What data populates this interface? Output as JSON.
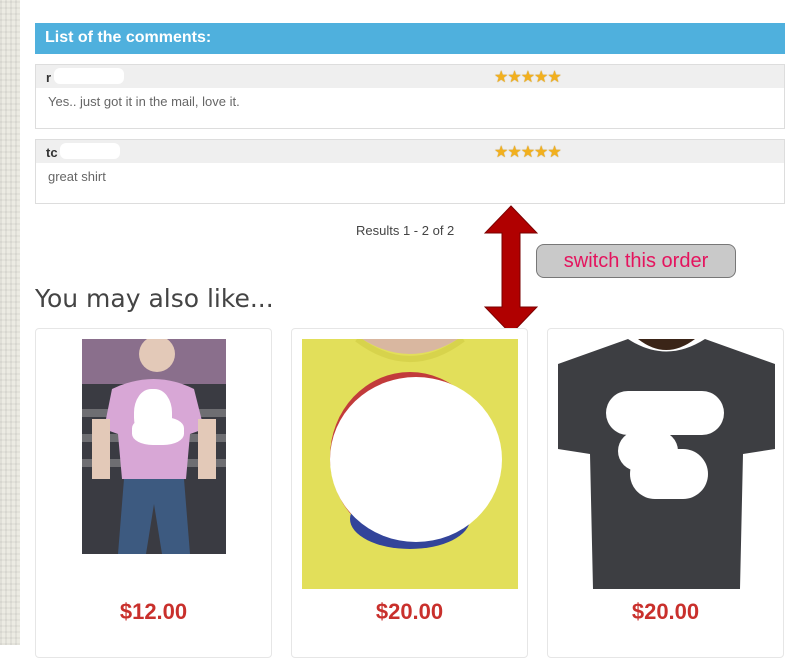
{
  "comments": {
    "header": "List of the comments:",
    "items": [
      {
        "author": "r",
        "stars": "★★★★★",
        "rating": 5,
        "text": "Yes.. just got it in the mail, love it."
      },
      {
        "author": "tc",
        "stars": "★★★★★",
        "rating": 5,
        "text": "great shirt"
      }
    ]
  },
  "pagination": {
    "results": "Results 1 - 2 of 2"
  },
  "annotation": {
    "note": "switch this order"
  },
  "related": {
    "heading": "You may also like...",
    "products": [
      {
        "price": "$12.00",
        "shirt_color": "#d8a7d6"
      },
      {
        "price": "$20.00",
        "shirt_color": "#e2df5a"
      },
      {
        "price": "$20.00",
        "shirt_color": "#3d3e42"
      }
    ]
  },
  "colors": {
    "header_bg": "#4fb0dd",
    "price": "#c9302c",
    "arrow": "#b00000",
    "note_text": "#e4145e"
  }
}
